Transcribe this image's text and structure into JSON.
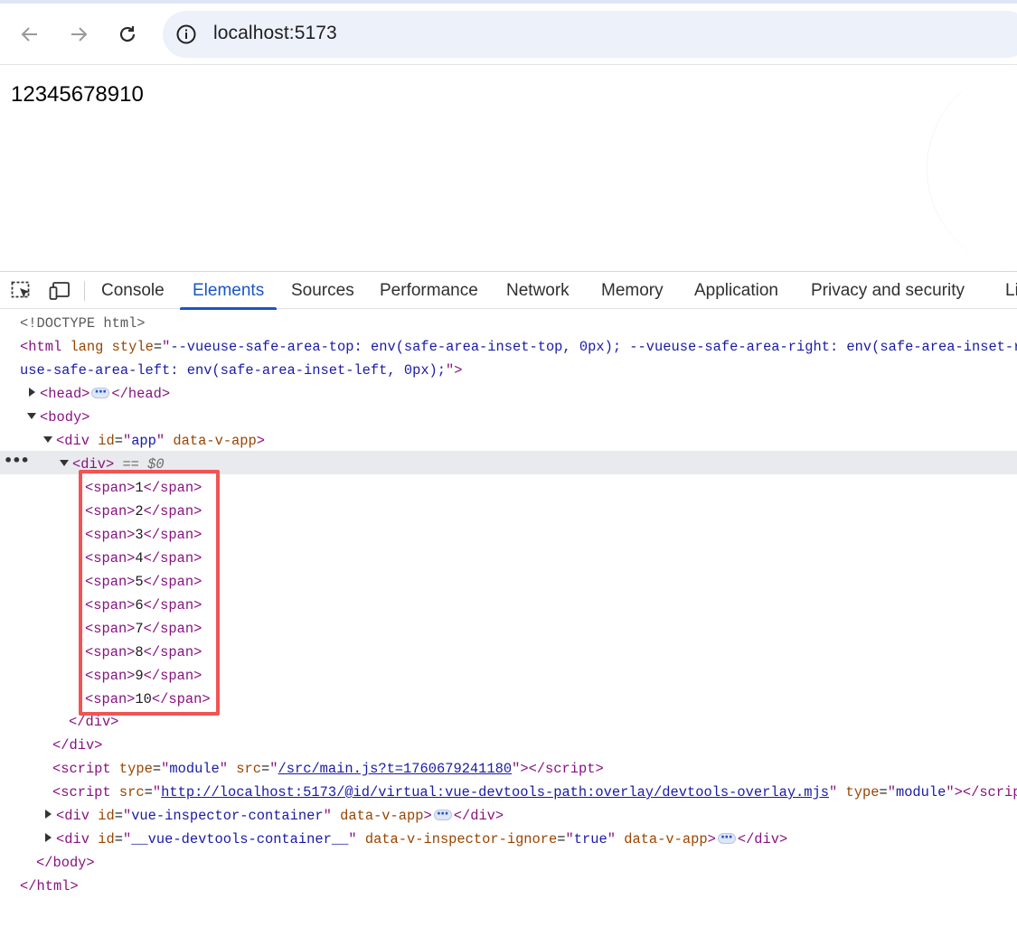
{
  "browser": {
    "url": "localhost:5173"
  },
  "page": {
    "content_text": "12345678910"
  },
  "devtools": {
    "tabs": [
      "Console",
      "Elements",
      "Sources",
      "Performance",
      "Network",
      "Memory",
      "Application",
      "Privacy and security",
      "Li"
    ],
    "active_tab": "Elements",
    "dom": {
      "doctype": "<!DOCTYPE html>",
      "html_open_1": "--vueuse-safe-area-top: env(safe-area-inset-top, 0px); --vueuse-safe-area-right: env(safe-area-inset-righ",
      "html_open_2": "use-safe-area-left: env(safe-area-inset-left, 0px);",
      "app_id": "app",
      "selected_marker": "== $0",
      "spans": [
        "1",
        "2",
        "3",
        "4",
        "5",
        "6",
        "7",
        "8",
        "9",
        "10"
      ],
      "script1_type": "module",
      "script1_src": "/src/main.js?t=1760679241180",
      "script2_src": "http://localhost:5173/@id/virtual:vue-devtools-path:overlay/devtools-overlay.mjs",
      "script2_type": "module",
      "inspector_id": "vue-inspector-container",
      "devtools_container_id": "__vue-devtools-container__",
      "inspector_ignore": "true"
    }
  }
}
